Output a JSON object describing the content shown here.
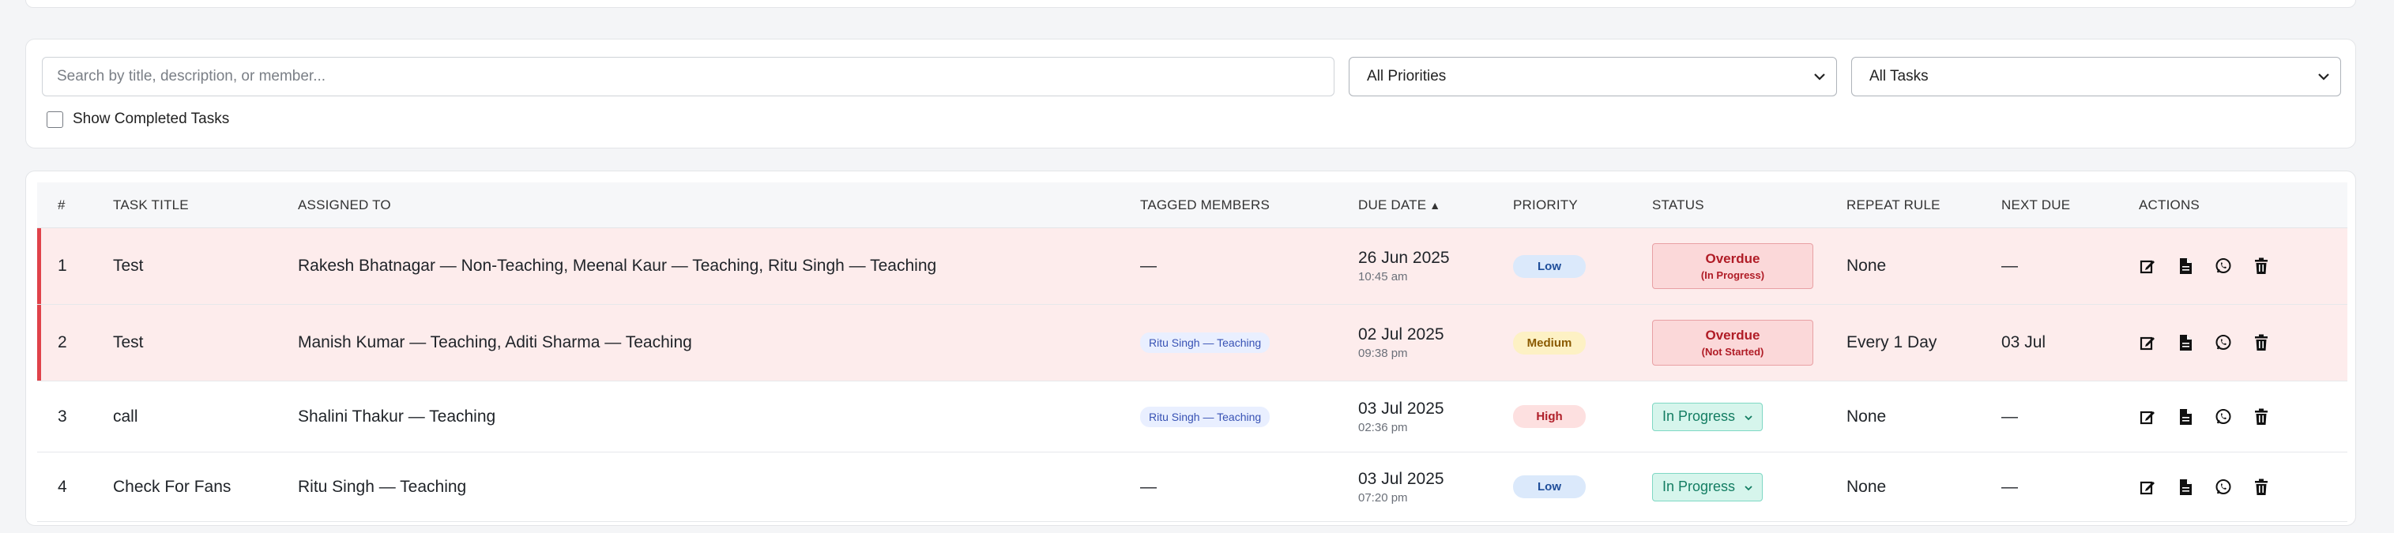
{
  "filters": {
    "search_placeholder": "Search by title, description, or member...",
    "priority_selected": "All Priorities",
    "tasks_selected": "All Tasks",
    "show_completed_label": "Show Completed Tasks",
    "show_completed_checked": false
  },
  "table": {
    "headers": {
      "num": "#",
      "title": "TASK TITLE",
      "assigned": "ASSIGNED TO",
      "tagged": "TAGGED MEMBERS",
      "due": "DUE DATE",
      "due_sort": "▲",
      "priority": "PRIORITY",
      "status": "STATUS",
      "repeat": "REPEAT RULE",
      "next_due": "NEXT DUE",
      "actions": "ACTIONS"
    },
    "rows": [
      {
        "num": "1",
        "title": "Test",
        "assigned": "Rakesh Bhatnagar — Non-Teaching, Meenal Kaur — Teaching, Ritu Singh — Teaching",
        "tagged": "—",
        "due_date": "26 Jun 2025",
        "due_time": "10:45 am",
        "priority": "Low",
        "status": "Overdue",
        "status_sub": "(In Progress)",
        "repeat": "None",
        "next_due": "—"
      },
      {
        "num": "2",
        "title": "Test",
        "assigned": "Manish Kumar — Teaching, Aditi Sharma — Teaching",
        "tagged": "Ritu Singh — Teaching",
        "due_date": "02 Jul 2025",
        "due_time": "09:38 pm",
        "priority": "Medium",
        "status": "Overdue",
        "status_sub": "(Not Started)",
        "repeat": "Every 1 Day",
        "next_due": "03 Jul"
      },
      {
        "num": "3",
        "title": "call",
        "assigned": "Shalini Thakur — Teaching",
        "tagged": "Ritu Singh — Teaching",
        "due_date": "03 Jul 2025",
        "due_time": "02:36 pm",
        "priority": "High",
        "status": "In Progress",
        "repeat": "None",
        "next_due": "—"
      },
      {
        "num": "4",
        "title": "Check For Fans",
        "assigned": "Ritu Singh — Teaching",
        "tagged": "—",
        "due_date": "03 Jul 2025",
        "due_time": "07:20 pm",
        "priority": "Low",
        "status": "In Progress",
        "repeat": "None",
        "next_due": "—"
      }
    ]
  },
  "icons": [
    "edit-icon",
    "document-icon",
    "whatsapp-icon",
    "trash-icon",
    "chevron-down-icon"
  ],
  "colors": {
    "overdue_accent": "#e0424a",
    "overdue_row_bg": "#fdecec",
    "in_progress": "#137d62"
  }
}
